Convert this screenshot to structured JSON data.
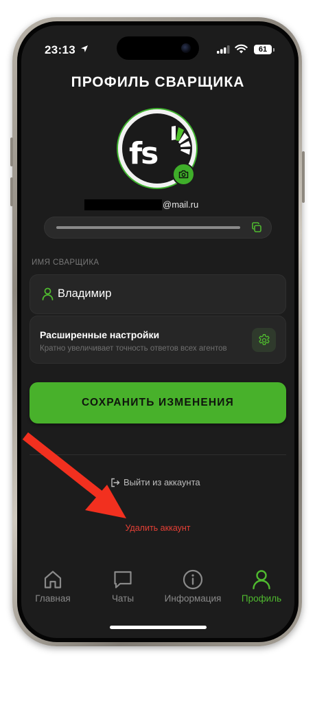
{
  "status_bar": {
    "time": "23:13",
    "battery": "61"
  },
  "header": {
    "title": "ПРОФИЛЬ СВАРЩИКА"
  },
  "profile": {
    "avatar_logo_text": "fs",
    "email_suffix": "@mail.ru"
  },
  "form": {
    "name_section_label": "ИМЯ СВАРЩИКА",
    "name_value": "Владимир",
    "advanced": {
      "title": "Расширенные настройки",
      "subtitle": "Кратно увеличивает точность ответов всех агентов"
    },
    "save_label": "СОХРАНИТЬ ИЗМЕНЕНИЯ"
  },
  "account": {
    "logout_label": "Выйти из аккаунта",
    "delete_label": "Удалить аккаунт"
  },
  "tabs": [
    {
      "label": "Главная",
      "icon": "home-icon",
      "active": false
    },
    {
      "label": "Чаты",
      "icon": "chat-icon",
      "active": false
    },
    {
      "label": "Информация",
      "icon": "info-icon",
      "active": false
    },
    {
      "label": "Профиль",
      "icon": "profile-icon",
      "active": true
    }
  ],
  "colors": {
    "accent": "#48b12b",
    "danger": "#e64036",
    "background": "#1c1c1c",
    "card": "#262626",
    "annotation_arrow": "#f2301f"
  }
}
